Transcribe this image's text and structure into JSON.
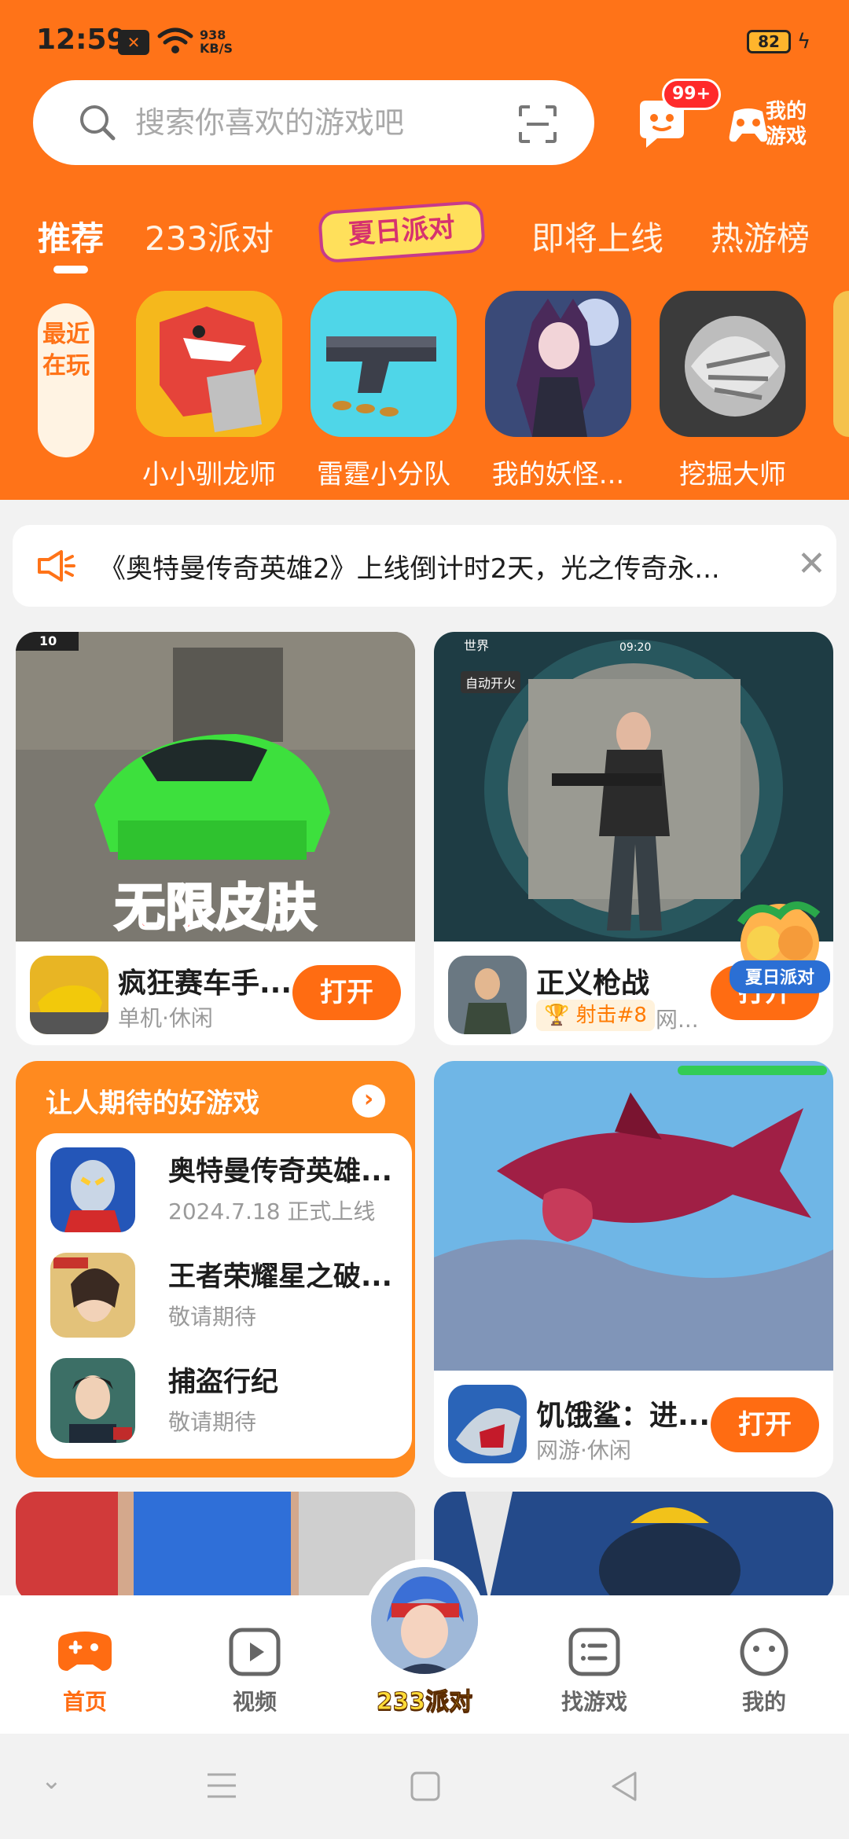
{
  "status_bar": {
    "time": "12:59",
    "net_speed_value": "938",
    "net_speed_unit": "KB/S",
    "battery": "82"
  },
  "search": {
    "placeholder": "搜索你喜欢的游戏吧",
    "message_badge": "99+",
    "my_games_label_1": "我的",
    "my_games_label_2": "游戏"
  },
  "tabs": [
    {
      "label": "推荐"
    },
    {
      "label": "233派对"
    },
    {
      "label": "夏日派对"
    },
    {
      "label": "即将上线"
    },
    {
      "label": "热游榜"
    }
  ],
  "recent": {
    "label": "最近在玩",
    "games": [
      {
        "name": "小小驯龙师"
      },
      {
        "name": "雷霆小分队"
      },
      {
        "name": "我的妖怪..."
      },
      {
        "name": "挖掘大师"
      }
    ]
  },
  "notice": {
    "text": "《奥特曼传奇英雄2》上线倒计时2天，光之传奇永..."
  },
  "feed": {
    "card1": {
      "overlay_text": "无限皮肤",
      "name": "疯狂赛车手...",
      "sub": "单机·休闲",
      "button": "打开",
      "corner_tag": "10"
    },
    "card2": {
      "name": "正义枪战",
      "rank_badge": "射击#8",
      "sub_extra": "网...",
      "hud_top": "世界",
      "hud_fire": "自动开火",
      "hud_time": "09:20",
      "overlay_logo": "夏日派对"
    },
    "expect": {
      "title": "让人期待的好游戏",
      "items": [
        {
          "name": "奥特曼传奇英雄...",
          "sub": "2024.7.18 正式上线"
        },
        {
          "name": "王者荣耀星之破...",
          "sub": "敬请期待"
        },
        {
          "name": "捕盗行纪",
          "sub": "敬请期待"
        }
      ]
    },
    "card3": {
      "name": "饥饿鲨：进...",
      "sub": "网游·休闲",
      "button": "打开"
    }
  },
  "bottom_nav": {
    "home": "首页",
    "video": "视频",
    "center": "233派对",
    "find": "找游戏",
    "mine": "我的"
  },
  "colors": {
    "brand_orange": "#ff7318",
    "button_orange": "#ff6c12",
    "badge_red": "#ff2a2a"
  }
}
